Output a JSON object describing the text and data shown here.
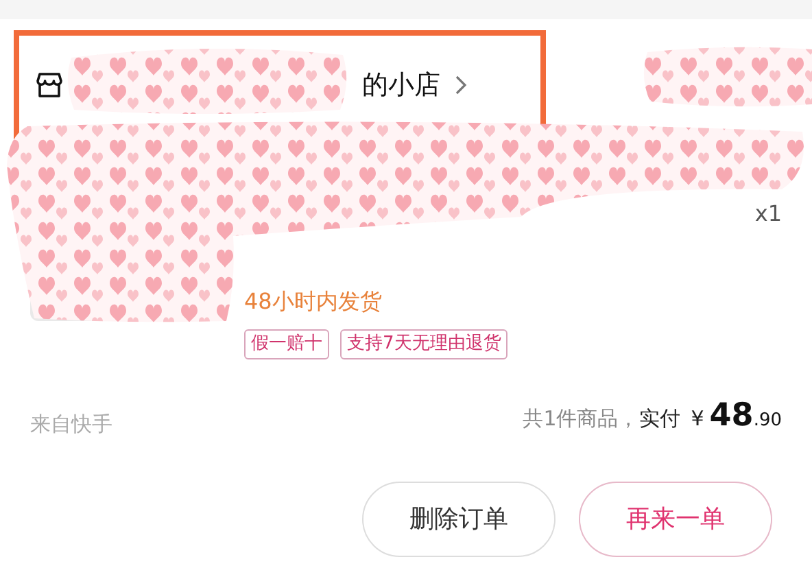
{
  "store": {
    "name": "的小店",
    "highlighted": true
  },
  "item": {
    "quantity": "x1",
    "shipping": "48小时内发货",
    "tags": [
      "假一赔十",
      "支持7天无理由退货"
    ]
  },
  "source": "来自快手",
  "summary": {
    "count": "共1件商品，",
    "paid_label": "实付",
    "currency": "¥",
    "amount_int": "48",
    "amount_dec": ".90"
  },
  "buttons": [
    {
      "label": "删除订单",
      "kind": "secondary"
    },
    {
      "label": "再来一单",
      "kind": "primary"
    }
  ]
}
